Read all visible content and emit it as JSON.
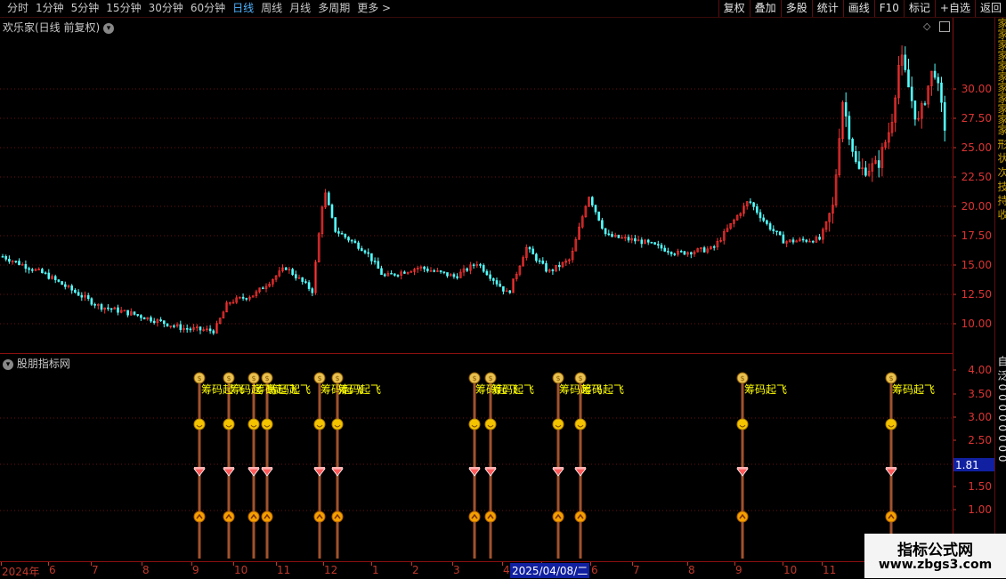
{
  "toolbar": {
    "periods": [
      "分时",
      "1分钟",
      "5分钟",
      "15分钟",
      "30分钟",
      "60分钟",
      "日线",
      "周线",
      "月线",
      "多周期",
      "更多 >"
    ],
    "active_period": "日线",
    "buttons": [
      "复权",
      "叠加",
      "多股",
      "统计",
      "画线",
      "F10",
      "标记",
      "+自选",
      "返回"
    ]
  },
  "main_chart": {
    "title": "欢乐家(日线 前复权)",
    "y_ticks": [
      "30.00",
      "27.50",
      "25.00",
      "22.50",
      "20.00",
      "17.50",
      "15.00",
      "12.50",
      "10.00"
    ],
    "up_color": "#ff3232",
    "down_color": "#54ffff"
  },
  "indicator": {
    "title": "股朋指标网",
    "y_ticks": [
      "4.00",
      "3.50",
      "3.00",
      "2.50",
      "2.00",
      "1.50",
      "1.00"
    ],
    "current_value": "1.81",
    "signal_label": "筹码起飞"
  },
  "x_axis": {
    "labels": [
      "2024年",
      "6",
      "7",
      "8",
      "9",
      "10",
      "11",
      "12",
      "1",
      "2",
      "3",
      "4",
      "5",
      "6",
      "7",
      "8",
      "9",
      "10",
      "11"
    ],
    "highlight": "2025/04/08/二"
  },
  "right_strip": {
    "text": "家家家家家家家家家家家 形 状 次 技 持 收",
    "lower_text": "自 泛 0 0 0 0 0 0 0 0"
  },
  "watermark": {
    "line1": "指标公式网",
    "line2": "www.zbgs3.com"
  }
}
